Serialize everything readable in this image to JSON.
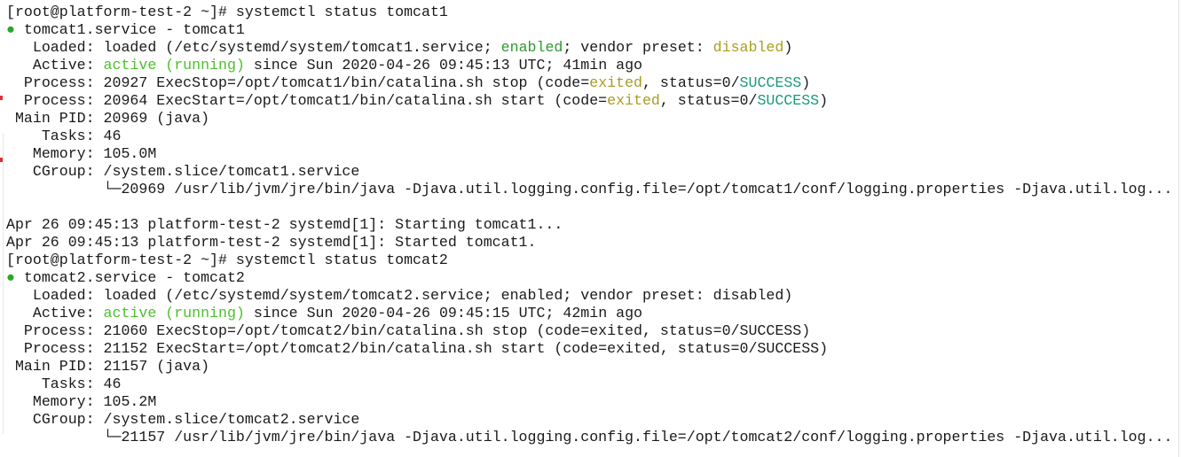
{
  "colors": {
    "text": "#1a1a1a",
    "active": "#4cc12c",
    "enabled": "#2e9a2e",
    "disabled": "#aaa020",
    "exited": "#aa9a22",
    "success": "#1a9a7a",
    "dot": "#2aa82a"
  },
  "terminal": {
    "lines": [
      [
        {
          "t": "[root@platform-test-2 ~]# systemctl status tomcat1"
        }
      ],
      [
        {
          "t": "●",
          "c": "dot"
        },
        {
          "t": " tomcat1.service - tomcat1"
        }
      ],
      [
        {
          "t": "   Loaded: loaded (/etc/systemd/system/tomcat1.service; "
        },
        {
          "t": "enabled",
          "c": "enabled"
        },
        {
          "t": "; vendor preset: "
        },
        {
          "t": "disabled",
          "c": "disabled"
        },
        {
          "t": ")"
        }
      ],
      [
        {
          "t": "   Active: "
        },
        {
          "t": "active (running)",
          "c": "active"
        },
        {
          "t": " since Sun 2020-04-26 09:45:13 UTC; 41min ago"
        }
      ],
      [
        {
          "t": "  Process: 20927 ExecStop=/opt/tomcat1/bin/catalina.sh stop (code="
        },
        {
          "t": "exited",
          "c": "exited"
        },
        {
          "t": ", status=0/"
        },
        {
          "t": "SUCCESS",
          "c": "success"
        },
        {
          "t": ")"
        }
      ],
      [
        {
          "t": "  Process: 20964 ExecStart=/opt/tomcat1/bin/catalina.sh start (code="
        },
        {
          "t": "exited",
          "c": "exited"
        },
        {
          "t": ", status=0/"
        },
        {
          "t": "SUCCESS",
          "c": "success"
        },
        {
          "t": ")"
        }
      ],
      [
        {
          "t": " Main PID: 20969 (java)"
        }
      ],
      [
        {
          "t": "    Tasks: 46"
        }
      ],
      [
        {
          "t": "   Memory: 105.0M"
        }
      ],
      [
        {
          "t": "   CGroup: /system.slice/tomcat1.service"
        }
      ],
      [
        {
          "t": "           └─20969 /usr/lib/jvm/jre/bin/java -Djava.util.logging.config.file=/opt/tomcat1/conf/logging.properties -Djava.util.log..."
        }
      ],
      [
        {
          "t": ""
        }
      ],
      [
        {
          "t": "Apr 26 09:45:13 platform-test-2 systemd[1]: Starting tomcat1..."
        }
      ],
      [
        {
          "t": "Apr 26 09:45:13 platform-test-2 systemd[1]: Started tomcat1."
        }
      ],
      [
        {
          "t": "[root@platform-test-2 ~]# systemctl status tomcat2"
        }
      ],
      [
        {
          "t": "●",
          "c": "dot"
        },
        {
          "t": " tomcat2.service - tomcat2"
        }
      ],
      [
        {
          "t": "   Loaded: loaded (/etc/systemd/system/tomcat2.service; enabled; vendor preset: disabled)"
        }
      ],
      [
        {
          "t": "   Active: "
        },
        {
          "t": "active (running)",
          "c": "active"
        },
        {
          "t": " since Sun 2020-04-26 09:45:15 UTC; 42min ago"
        }
      ],
      [
        {
          "t": "  Process: 21060 ExecStop=/opt/tomcat2/bin/catalina.sh stop (code=exited, status=0/SUCCESS)"
        }
      ],
      [
        {
          "t": "  Process: 21152 ExecStart=/opt/tomcat2/bin/catalina.sh start (code=exited, status=0/SUCCESS)"
        }
      ],
      [
        {
          "t": " Main PID: 21157 (java)"
        }
      ],
      [
        {
          "t": "    Tasks: 46"
        }
      ],
      [
        {
          "t": "   Memory: 105.2M"
        }
      ],
      [
        {
          "t": "   CGroup: /system.slice/tomcat2.service"
        }
      ],
      [
        {
          "t": "           └─21157 /usr/lib/jvm/jre/bin/java -Djava.util.logging.config.file=/opt/tomcat2/conf/logging.properties -Djava.util.log..."
        }
      ]
    ]
  }
}
